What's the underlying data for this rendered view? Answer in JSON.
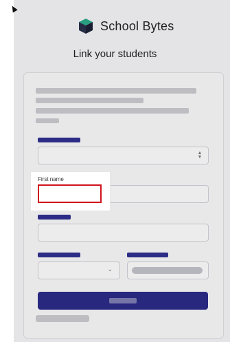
{
  "brand": {
    "name": "School Bytes",
    "logo_icon": "cube-logo-icon"
  },
  "page": {
    "title": "Link your students"
  },
  "form": {
    "highlighted_field": {
      "label": "First name",
      "value": ""
    }
  },
  "colors": {
    "accent": "#2b2b87",
    "highlight_border": "#d0121b",
    "background": "#f3f3f5"
  }
}
